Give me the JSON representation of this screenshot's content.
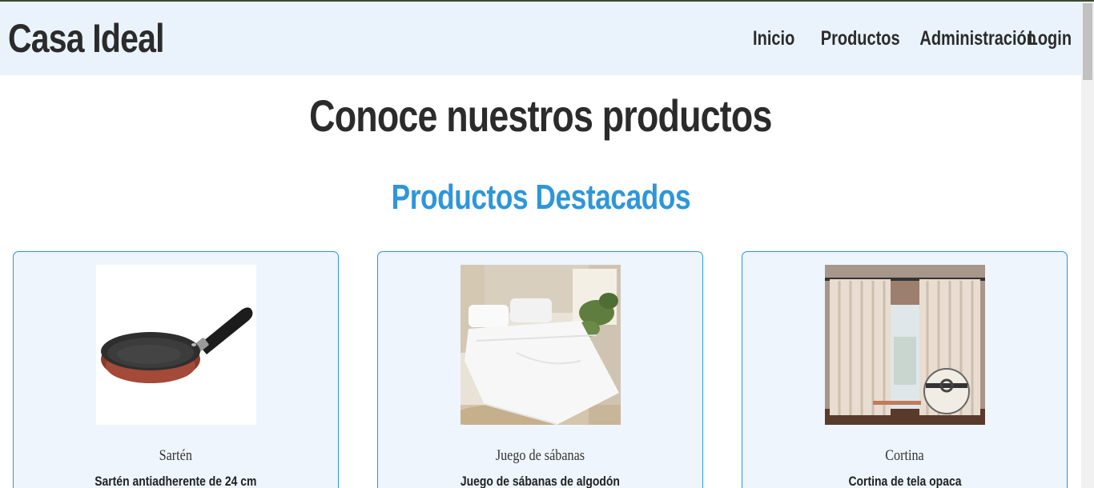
{
  "header": {
    "brand": "Casa Ideal",
    "nav": [
      "Inicio",
      "Productos",
      "Administración",
      "Login"
    ]
  },
  "main": {
    "title": "Conoce nuestros productos",
    "section_title": "Productos Destacados",
    "products": [
      {
        "name": "Sartén",
        "description": "Sartén antiadherente de 24 cm",
        "image_icon": "frying-pan-image"
      },
      {
        "name": "Juego de sábanas",
        "description": "Juego de sábanas de algodón",
        "image_icon": "bed-sheets-image"
      },
      {
        "name": "Cortina",
        "description": "Cortina de tela opaca",
        "image_icon": "curtain-image"
      }
    ]
  },
  "colors": {
    "header_bg": "#eaf3fc",
    "accent": "#2f96d8",
    "card_bg": "#eef5fd",
    "text": "#2b2b2b"
  }
}
